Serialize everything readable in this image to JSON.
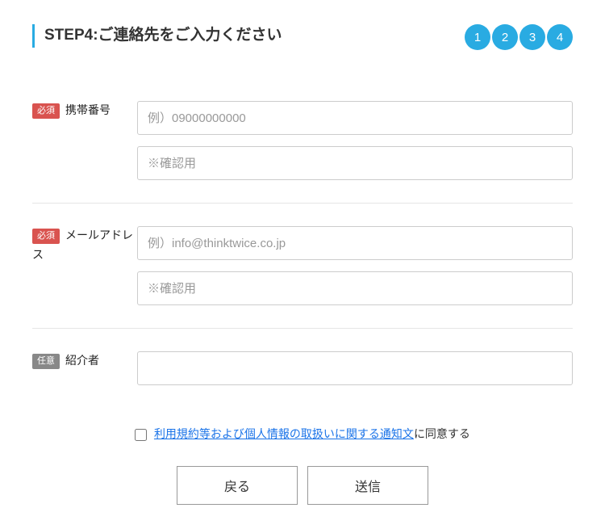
{
  "header": {
    "title": "STEP4:ご連絡先をご入力ください",
    "steps": [
      "1",
      "2",
      "3",
      "4"
    ]
  },
  "badges": {
    "required": "必須",
    "optional": "任意"
  },
  "fields": {
    "phone": {
      "label": "携帯番号",
      "placeholder": "例）09000000000",
      "confirm_placeholder": "※確認用",
      "value": "",
      "confirm_value": ""
    },
    "email": {
      "label": "メールアドレス",
      "placeholder": "例）info@thinktwice.co.jp",
      "confirm_placeholder": "※確認用",
      "value": "",
      "confirm_value": ""
    },
    "referrer": {
      "label": "紹介者",
      "placeholder": "",
      "value": ""
    }
  },
  "consent": {
    "link_text": "利用規約等および個人情報の取扱いに関する通知文",
    "suffix_text": "に同意する",
    "checked": false
  },
  "buttons": {
    "back": "戻る",
    "submit": "送信"
  }
}
